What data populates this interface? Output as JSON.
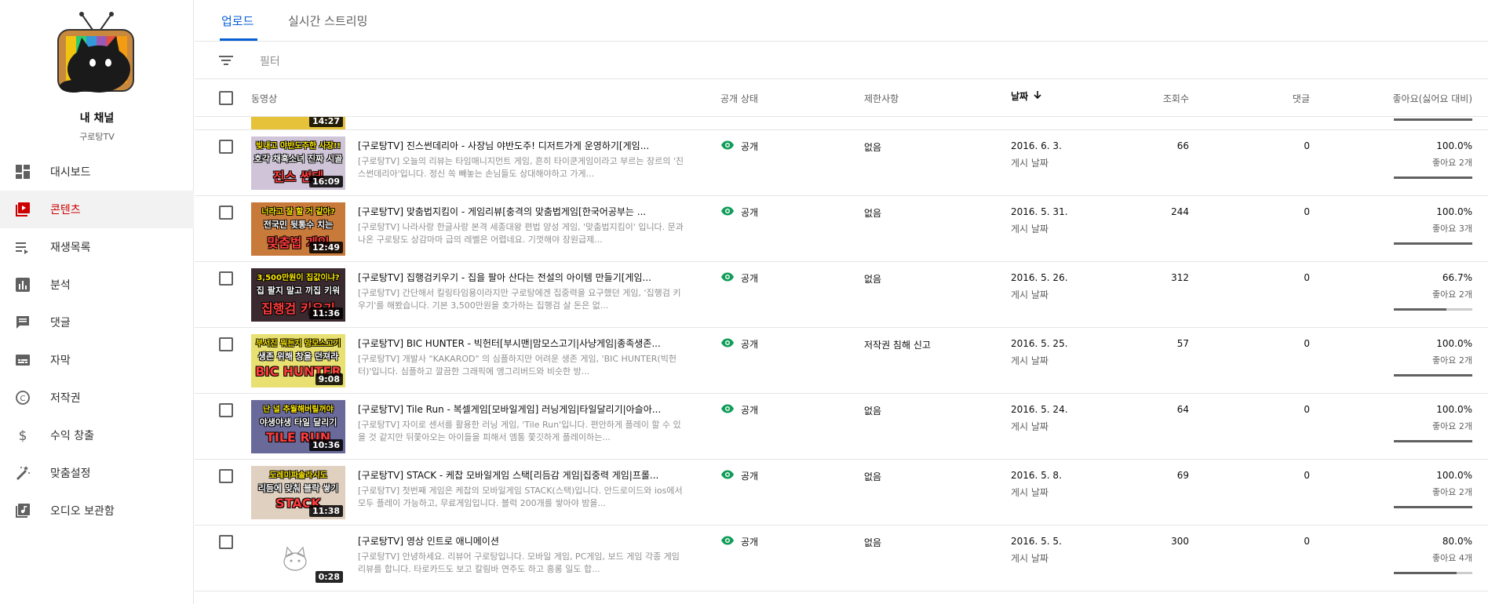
{
  "channel": {
    "title": "내 채널",
    "subtitle": "구로탕TV"
  },
  "nav": [
    {
      "label": "대시보드",
      "icon": "dashboard-icon"
    },
    {
      "label": "콘텐츠",
      "icon": "content-icon",
      "active": true
    },
    {
      "label": "재생목록",
      "icon": "playlist-icon"
    },
    {
      "label": "분석",
      "icon": "analytics-icon"
    },
    {
      "label": "댓글",
      "icon": "comments-icon"
    },
    {
      "label": "자막",
      "icon": "subtitles-icon"
    },
    {
      "label": "저작권",
      "icon": "copyright-icon"
    },
    {
      "label": "수익 창출",
      "icon": "dollar-icon"
    },
    {
      "label": "맞춤설정",
      "icon": "wand-icon"
    },
    {
      "label": "오디오 보관함",
      "icon": "audio-library-icon"
    }
  ],
  "tabs": [
    {
      "label": "업로드",
      "active": true
    },
    {
      "label": "실시간 스트리밍",
      "active": false
    }
  ],
  "filter": {
    "placeholder": "필터"
  },
  "columns": {
    "video": "동영상",
    "visibility": "공개 상태",
    "restrictions": "제한사항",
    "date": "날짜",
    "views": "조회수",
    "comments": "댓글",
    "likes": "좋아요(싫어요 대비)"
  },
  "partial_row": {
    "duration": "14:27"
  },
  "rows": [
    {
      "duration": "16:09",
      "thumb_lines": [
        "빚내고 야반도주한 사장!!",
        "호각 채혹소녀 진짜 시골",
        "진스 썬데"
      ],
      "thumb_bg": "#cfc4d8",
      "title": "[구로탕TV] 진스썬데리아 - 사장님 야반도주! 디저트가게 운영하기[게임...",
      "desc": "[구로탕TV] 오늘의 리뷰는 타임매니지먼트 게임, 흔히 타이쿤게임이라고 부르는 장르의 '진스썬데리아'입니다. 정신 쏙 빼놓는 손님들도 상대해야하고 가게...",
      "visibility": "공개",
      "restrictions": "없음",
      "date": "2016. 6. 3.",
      "date_sub": "게시 날짜",
      "views": "66",
      "comments": "0",
      "likes_pct": "100.0%",
      "likes_sub": "좋아요 2개",
      "likes_ratio": 1.0
    },
    {
      "duration": "12:49",
      "thumb_lines": [
        "너라고 잘 할 거 같아?",
        "전국민 뒷통수 치는",
        "맞춤법 게임"
      ],
      "thumb_bg": "#c87a3a",
      "title": "[구로탕TV] 맞춤법지킴이 - 게임리뷰[충격의 맞춤법게임[한국어공부는 ...",
      "desc": "[구로탕TV] 나라사랑 한글사랑 본격 세종대왕 편법 양성 게임, '맞춤법지킴이' 입니다. 문과 나온 구로탕도 상감마마 급의 레벨은 어렵네요. 기껏해야 장원급제...",
      "visibility": "공개",
      "restrictions": "없음",
      "date": "2016. 5. 31.",
      "date_sub": "게시 날짜",
      "views": "244",
      "comments": "0",
      "likes_pct": "100.0%",
      "likes_sub": "좋아요 3개",
      "likes_ratio": 1.0
    },
    {
      "duration": "11:36",
      "thumb_lines": [
        "3,500만원이 집값이냐?",
        "집 팔지 말고 끼집 키워",
        "집행검 키우기"
      ],
      "thumb_bg": "#3a2a30",
      "title": "[구로탕TV] 집행검키우기 - 집을 팔아 산다는 전설의 아이템 만들기[게임...",
      "desc": "[구로탕TV] 간단해서 킬링타임용이라지만 구로탕에겐 집중력을 요구했던 게임, '집행검 키우기'를 해봤습니다. 기본 3,500만원을 호가하는 집행검 살 돈은 없...",
      "visibility": "공개",
      "restrictions": "없음",
      "date": "2016. 5. 26.",
      "date_sub": "게시 날짜",
      "views": "312",
      "comments": "0",
      "likes_pct": "66.7%",
      "likes_sub": "좋아요 2개",
      "likes_ratio": 0.667
    },
    {
      "duration": "9:08",
      "thumb_lines": [
        "부서진 뭐든지 망모스고기",
        "생존 위해 창을 던져라",
        "BIC HUNTER"
      ],
      "thumb_bg": "#e8e070",
      "title": "[구로탕TV] BIC HUNTER - 빅헌터[부시맨|맘모스고기|사냥게임|종족생존...",
      "desc": "[구로탕TV] 개발사 \"KAKAROD\" 의 심플하지만 어려운 생존 게임, 'BIC HUNTER(빅헌터)'입니다. 심플하고 깔끔한 그래픽에 앵그리버드와 비슷한 방...",
      "visibility": "공개",
      "restrictions": "저작권 침해 신고",
      "date": "2016. 5. 25.",
      "date_sub": "게시 날짜",
      "views": "57",
      "comments": "0",
      "likes_pct": "100.0%",
      "likes_sub": "좋아요 2개",
      "likes_ratio": 1.0
    },
    {
      "duration": "10:36",
      "thumb_lines": [
        "난 널 추월해버릴꺼야",
        "야생야생 타일 달리기",
        "TILE RUN"
      ],
      "thumb_bg": "#6a6a9a",
      "title": "[구로탕TV] Tile Run - 복셀게임[모바일게임] 러닝게임|타일달리기|아슬아...",
      "desc": "[구로탕TV] 자이로 센서를 활용한 러닝 게임, 'Tile Run'입니다. 편안하게 플레이 할 수 있을 것 같지만 뒤쫓아오는 아이들을 피해서 엠통 쫓깃하게 플레이하는...",
      "visibility": "공개",
      "restrictions": "없음",
      "date": "2016. 5. 24.",
      "date_sub": "게시 날짜",
      "views": "64",
      "comments": "0",
      "likes_pct": "100.0%",
      "likes_sub": "좋아요 2개",
      "likes_ratio": 1.0
    },
    {
      "duration": "11:38",
      "thumb_lines": [
        "도레미파솔라시도",
        "리듬에 맞춰 블락 쌓기",
        "STACK"
      ],
      "thumb_bg": "#e0d0c0",
      "title": "[구로탕TV] STACK - 케찹 모바일게임 스택[리듬감 게임|집중력 게임|프롤...",
      "desc": "[구로탕TV] 첫번째 게임은 케찹의 모바일게임 STACK(스택)입니다. 안드로이드와 ios에서 모두 플레이 가능하고, 무료게임입니다. 블럭 200개를 쌓아야 밤을...",
      "visibility": "공개",
      "restrictions": "없음",
      "date": "2016. 5. 8.",
      "date_sub": "게시 날짜",
      "views": "69",
      "comments": "0",
      "likes_pct": "100.0%",
      "likes_sub": "좋아요 2개",
      "likes_ratio": 1.0
    },
    {
      "duration": "0:28",
      "thumb_lines": [],
      "thumb_bg": "#ffffff",
      "title": "[구로탕TV] 영상 인트로 애니메이션",
      "desc": "[구로탕TV] 안녕하세요. 리뷰어 구로탕입니다. 모바일 게임, PC게임, 보드 게임 각종 게임 리뷰를 합니다. 타로카드도 보고 칼림바 연주도 하고 흥롱 일도 합...",
      "visibility": "공개",
      "restrictions": "없음",
      "date": "2016. 5. 5.",
      "date_sub": "게시 날짜",
      "views": "300",
      "comments": "0",
      "likes_pct": "80.0%",
      "likes_sub": "좋아요 4개",
      "likes_ratio": 0.8
    }
  ]
}
